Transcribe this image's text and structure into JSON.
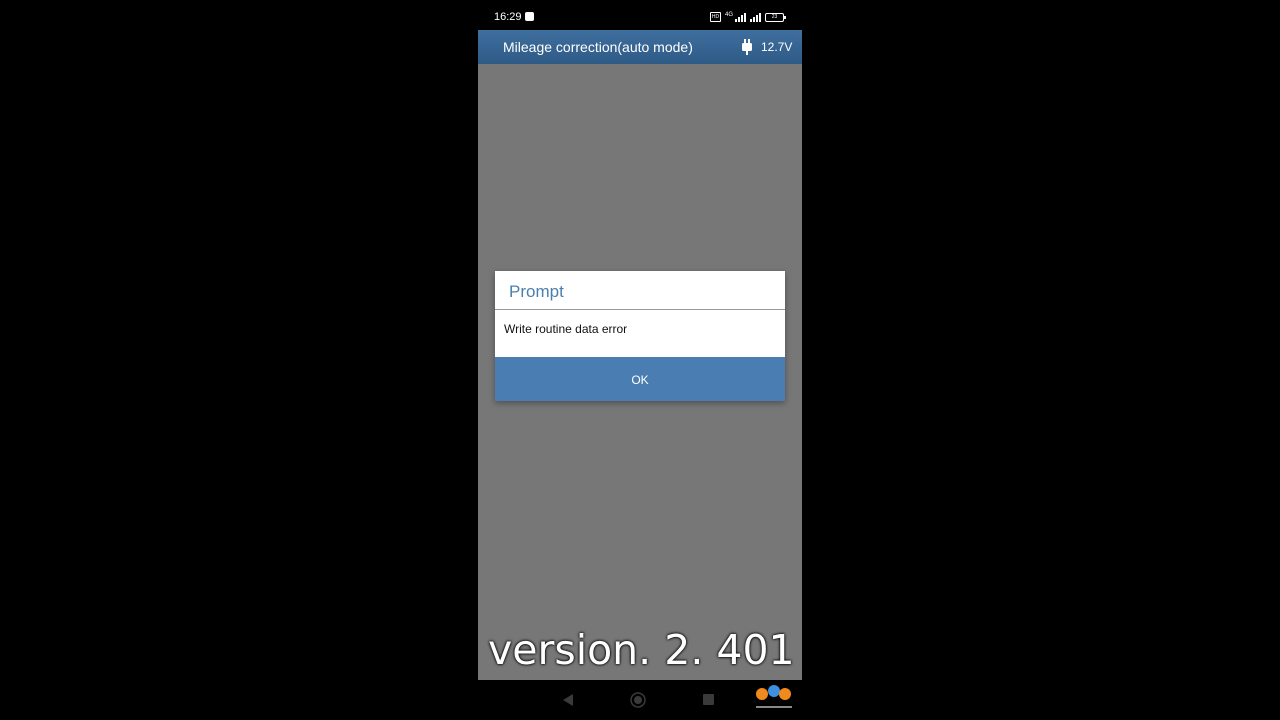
{
  "status_bar": {
    "time": "16:29",
    "network_label": "4G",
    "hd_label": "HD",
    "battery_level": "23"
  },
  "header": {
    "title": "Mileage correction(auto mode)",
    "voltage": "12.7V",
    "accent_color": "#3a6898"
  },
  "dialog": {
    "title": "Prompt",
    "message": "Write routine data error",
    "ok_label": "OK",
    "button_color": "#4a7db1"
  },
  "caption": {
    "text": "version. 2. 401"
  },
  "nav_bar": {
    "icons": [
      "back-icon",
      "home-icon",
      "recent-apps-icon"
    ]
  },
  "watermark": {
    "logo": "obd-logo"
  }
}
